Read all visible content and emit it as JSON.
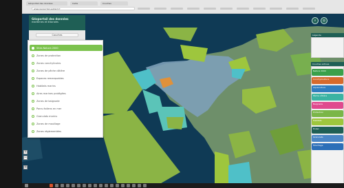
{
  "browser": {
    "tabs": [
      "Géoportail des données",
      "Carte",
      "Couches"
    ],
    "url": "www.geoportail.sextant.fr"
  },
  "app": {
    "title": "Géoportail des données",
    "subtitle": "maritimes et littorales"
  },
  "layer_selector": {
    "label": "Couches"
  },
  "layers": [
    "Sites Natura 2000",
    "Zones de protection",
    "Zones conchylicoles",
    "Zones de pêche côtière",
    "Espaces remarquables",
    "Habitats marins",
    "Aires marines protégées",
    "Zones de baignade",
    "Parcs éoliens en mer",
    "Granulats marins",
    "Zones de mouillage",
    "Zones réglementées"
  ],
  "right_panel": {
    "header_top": "Légende",
    "header_layers": "Couches actives",
    "legend": [
      {
        "label": "Natura 2000",
        "color": "#3aa04a"
      },
      {
        "label": "Conchyliculture",
        "color": "#d66a2c"
      },
      {
        "label": "Aquaculture",
        "color": "#2f7dbf"
      },
      {
        "label": "Pêche côtière",
        "color": "#3bb3a3"
      },
      {
        "label": "Baignade",
        "color": "#e04a8e"
      },
      {
        "label": "Protection",
        "color": "#7ab648"
      },
      {
        "label": "Habitats",
        "color": "#9ec63d"
      },
      {
        "label": "Éolien",
        "color": "#1f5f55"
      },
      {
        "label": "Granulats",
        "color": "#4a86c5"
      },
      {
        "label": "Mouillage",
        "color": "#2c6fb8"
      }
    ]
  },
  "colors": {
    "sea": "#0f3a55",
    "accent": "#7cc24d",
    "header": "#1f5f55"
  },
  "icons": {
    "search": "search-icon",
    "layers": "layers-icon",
    "zoom_in": "plus-icon",
    "zoom_out": "minus-icon"
  }
}
